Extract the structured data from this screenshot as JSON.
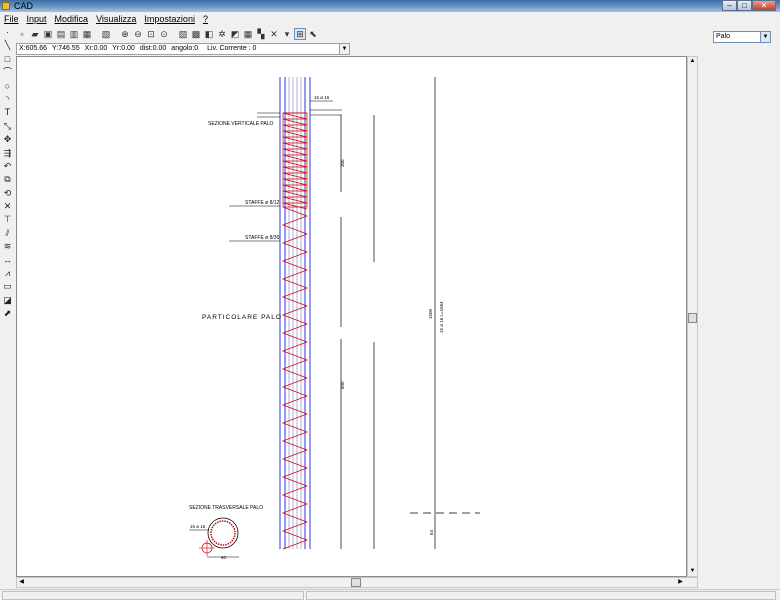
{
  "window": {
    "title": "CAD",
    "min_label": "–",
    "max_label": "□",
    "close_label": "✕"
  },
  "menu": [
    {
      "label": "File"
    },
    {
      "label": "Input"
    },
    {
      "label": "Modifica"
    },
    {
      "label": "Visualizza"
    },
    {
      "label": "Impostazioni"
    },
    {
      "label": "?"
    }
  ],
  "status": {
    "x": "X:605.66",
    "y": "Y:746.55",
    "xr": "Xr:0.00",
    "yr": "Yr:0.00",
    "dist": "dist:0.00",
    "angolo": "angolo:0",
    "livello": "Liv. Corrente : 0"
  },
  "layer_select": {
    "value": "Palo"
  },
  "drawing": {
    "labels": {
      "sezione_verticale": "SEZIONE VERTICALE PALO",
      "staffe_12": "STAFFE ø 8/12",
      "staffe_30": "STAFFE ø 8/30",
      "particolare": "PARTICOLARE   PALO",
      "sezione_trasversale": "SEZIONE TRASVERSALE PALO",
      "ferri_top": "15 ø 16",
      "ferri_section": "15 ø 16",
      "dim_long": "15 ø 16  L=1664",
      "dim_1500": "1500",
      "dim_300": "300",
      "dim_600": "600",
      "dim_64": "64",
      "dim_60": "60"
    }
  },
  "colors": {
    "accent": "#3a6ea5",
    "rebar": "#cc0000",
    "outline": "#0000cc"
  },
  "icons": {
    "left_tools": [
      "point-icon",
      "line-icon",
      "rectangle-icon",
      "polyline-icon",
      "circle-icon",
      "arc-icon",
      "text-icon",
      "dimension-icon",
      "move-icon",
      "copy-icon",
      "rotate-icon",
      "mirror-icon",
      "scale-icon",
      "delete-icon",
      "trim-icon",
      "extend-icon",
      "hatch-icon",
      "dim-linear-icon",
      "dim-aligned-icon",
      "layer-icon",
      "measure-icon",
      "select-icon"
    ]
  }
}
